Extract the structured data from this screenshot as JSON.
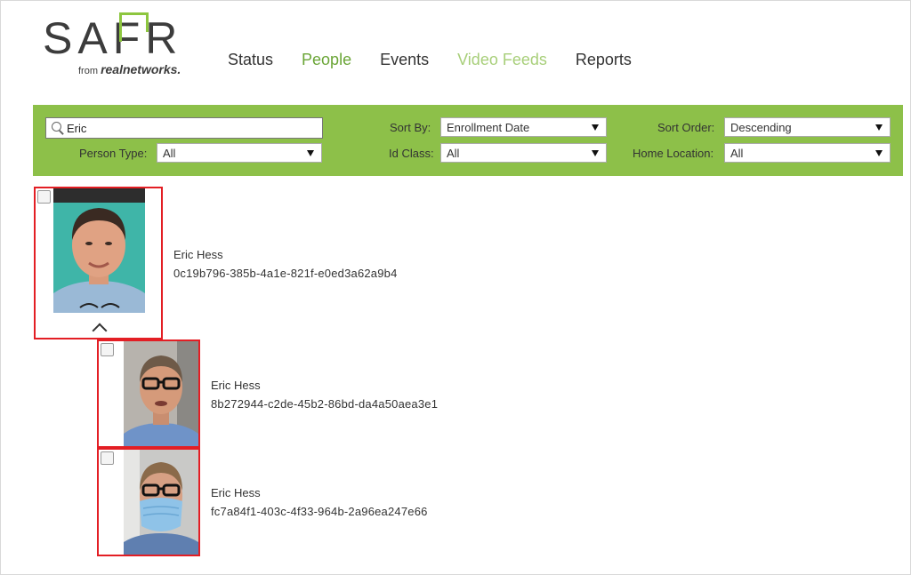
{
  "logo": {
    "word": "SAFR",
    "sub_from": "from",
    "sub_brand": "realnetworks."
  },
  "nav": [
    {
      "label": "Status"
    },
    {
      "label": "People"
    },
    {
      "label": "Events"
    },
    {
      "label": "Video Feeds"
    },
    {
      "label": "Reports"
    }
  ],
  "filters": {
    "search_value": "Eric",
    "person_type_label": "Person Type:",
    "person_type_value": "All",
    "sort_by_label": "Sort By:",
    "sort_by_value": "Enrollment Date",
    "id_class_label": "Id Class:",
    "id_class_value": "All",
    "sort_order_label": "Sort Order:",
    "sort_order_value": "Descending",
    "home_location_label": "Home Location:",
    "home_location_value": "All"
  },
  "people": [
    {
      "name": "Eric Hess",
      "id": "0c19b796-385b-4a1e-821f-e0ed3a62a9b4"
    },
    {
      "name": "Eric Hess",
      "id": "8b272944-c2de-45b2-86bd-da4a50aea3e1"
    },
    {
      "name": "Eric Hess",
      "id": "fc7a84f1-403c-4f33-964b-2a96ea247e66"
    }
  ],
  "colors": {
    "brand_green": "#8dc049",
    "active_nav": "#6aa536",
    "card_border": "#e31e24"
  }
}
